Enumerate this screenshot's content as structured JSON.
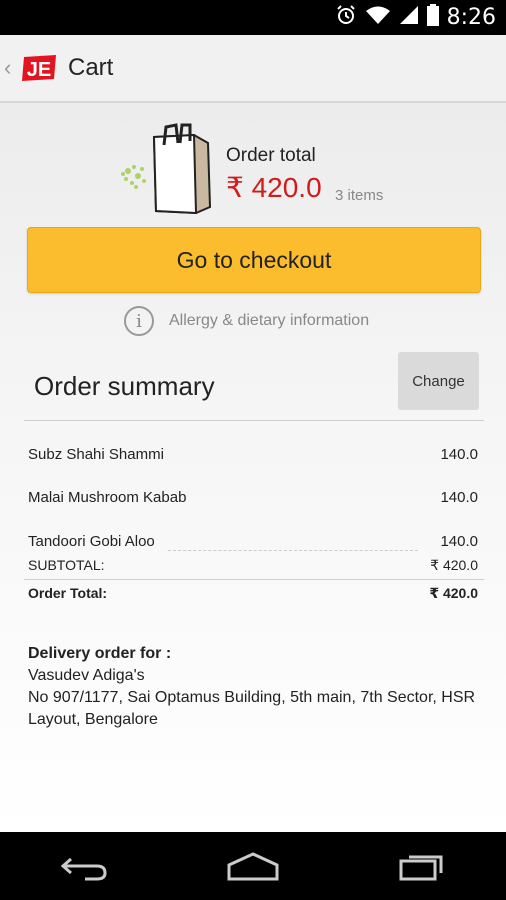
{
  "status_bar": {
    "time": "8:26",
    "icons": [
      "alarm-icon",
      "wifi-icon",
      "signal-icon",
      "battery-icon"
    ]
  },
  "action_bar": {
    "logo_text": "JE",
    "title": "Cart"
  },
  "order_total": {
    "label": "Order total",
    "amount": "₹ 420.0",
    "items": "3 items"
  },
  "checkout_label": "Go to checkout",
  "allergy_label": "Allergy & dietary information",
  "summary": {
    "title": "Order summary",
    "change_label": "Change",
    "items": [
      {
        "name": "Subz Shahi Shammi",
        "price": "140.0"
      },
      {
        "name": "Malai Mushroom Kabab",
        "price": "140.0"
      },
      {
        "name": "Tandoori Gobi Aloo",
        "price": "140.0"
      }
    ],
    "subtotal_label": "SUBTOTAL:",
    "subtotal_value": "₹ 420.0",
    "total_label": "Order Total:",
    "total_value": "₹ 420.0"
  },
  "delivery": {
    "heading": "Delivery order for :",
    "name": "Vasudev Adiga's",
    "address": "No 907/1177, Sai Optamus Building, 5th main, 7th Sector, HSR Layout, Bengalore"
  },
  "colors": {
    "accent_yellow": "#fbbd2e",
    "price_red": "#d11a1a",
    "logo_red": "#e3141f"
  }
}
